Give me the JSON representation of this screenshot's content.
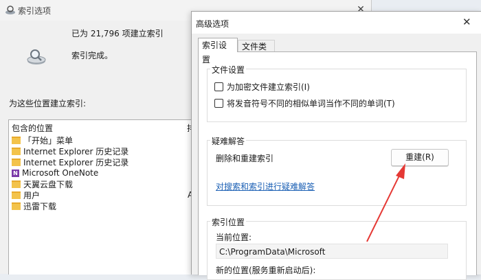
{
  "back_window": {
    "title": "索引选项",
    "stat_count": "已为 21,796 项建立索引",
    "stat_done": "索引完成。",
    "index_label": "为这些位置建立索引:",
    "list_header": "包含的位置",
    "list_header2": "排",
    "locations": [
      {
        "label": "「开始」菜单",
        "icon": "folder-icon"
      },
      {
        "label": "Internet Explorer 历史记录",
        "icon": "folder-icon"
      },
      {
        "label": "Internet Explorer 历史记录",
        "icon": "folder-icon"
      },
      {
        "label": "Microsoft OneNote",
        "icon": "onenote-icon"
      },
      {
        "label": "天翼云盘下载",
        "icon": "folder-icon"
      },
      {
        "label": "用户",
        "icon": "folder-icon",
        "extra": "A"
      },
      {
        "label": "迅雷下载",
        "icon": "folder-icon"
      }
    ]
  },
  "dialog": {
    "title": "高级选项",
    "tabs": [
      {
        "label": "索引设置",
        "active": true
      },
      {
        "label": "文件类型",
        "active": false
      }
    ],
    "file_settings": {
      "title": "文件设置",
      "options": [
        {
          "label": "为加密文件建立索引(I)",
          "checked": false
        },
        {
          "label": "将发音符号不同的相似单词当作不同的单词(T)",
          "checked": false
        }
      ]
    },
    "troubleshooting": {
      "title": "疑难解答",
      "rebuild_label": "删除和重建索引",
      "rebuild_button": "重建(R)",
      "link": "对搜索和索引进行疑难解答"
    },
    "index_location": {
      "title": "索引位置",
      "current_label": "当前位置:",
      "current_value": "C:\\ProgramData\\Microsoft",
      "new_label": "新的位置(服务重新启动后):"
    }
  },
  "colors": {
    "accent_arrow": "#e53935",
    "link": "#1a5fb4"
  }
}
